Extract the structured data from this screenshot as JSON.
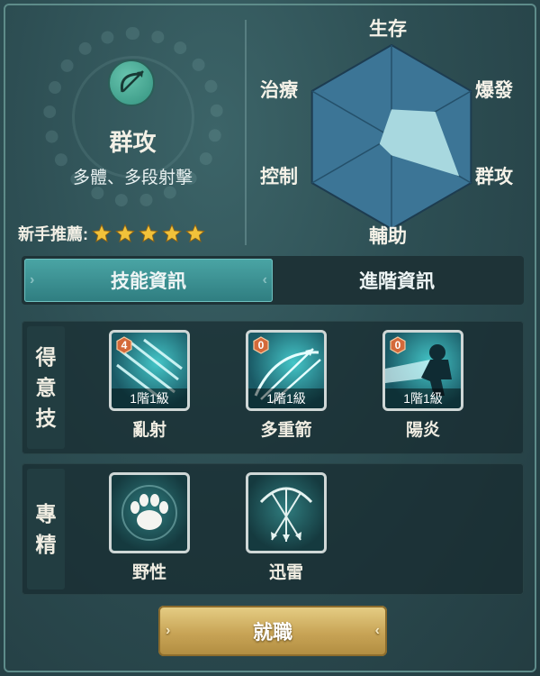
{
  "class_info": {
    "title": "群攻",
    "description": "多體、多段射擊",
    "recommend_label": "新手推薦:",
    "recommend_stars": 5
  },
  "radar": {
    "axes": [
      "生存",
      "爆發",
      "群攻",
      "輔助",
      "控制",
      "治療"
    ],
    "values": [
      0.3,
      0.55,
      0.85,
      0.2,
      0.15,
      0.1
    ]
  },
  "tabs": [
    {
      "label": "技能資訊",
      "active": true
    },
    {
      "label": "進階資訊",
      "active": false
    }
  ],
  "signature_section": {
    "label": "得意技",
    "skills": [
      {
        "name": "亂射",
        "badge": "4",
        "level": "1階1級",
        "icon": "arrow-rain-icon"
      },
      {
        "name": "多重箭",
        "badge": "0",
        "level": "1階1級",
        "icon": "multi-arrow-icon"
      },
      {
        "name": "陽炎",
        "badge": "0",
        "level": "1階1級",
        "icon": "dash-silhouette-icon"
      }
    ]
  },
  "mastery_section": {
    "label": "專精",
    "skills": [
      {
        "name": "野性",
        "icon": "paw-icon"
      },
      {
        "name": "迅雷",
        "icon": "bow-arrows-icon"
      }
    ]
  },
  "job_button": "就職"
}
